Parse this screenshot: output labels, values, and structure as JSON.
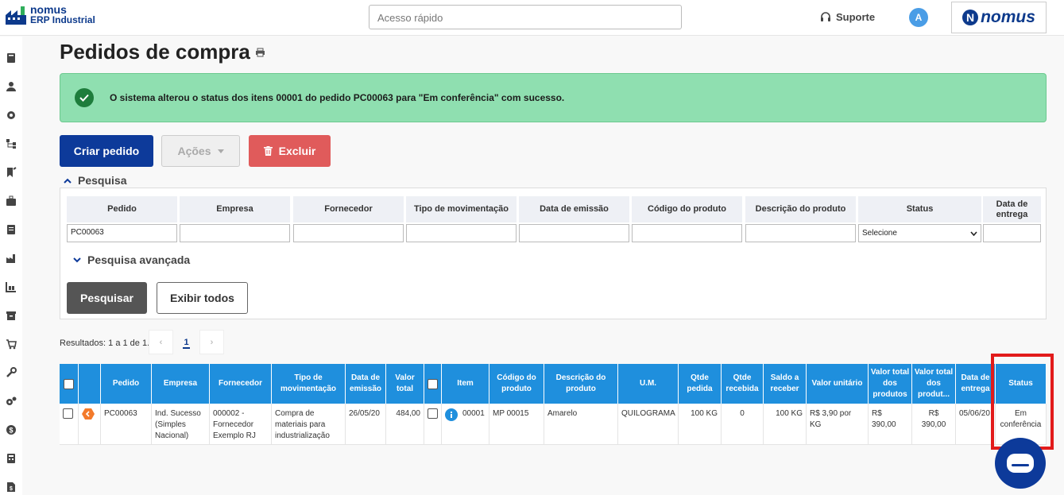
{
  "header": {
    "logo_line1": "nomus",
    "logo_line2": "ERP Industrial",
    "quick_access_placeholder": "Acesso rápido",
    "support_label": "Suporte",
    "avatar_letter": "A",
    "brand_letter": "N",
    "brand_word": "nomus"
  },
  "page": {
    "title": "Pedidos de compra",
    "alert_message": "O sistema alterou o status dos itens 00001 do pedido PC00063 para \"Em conferência\" com sucesso."
  },
  "toolbar": {
    "create_label": "Criar pedido",
    "actions_label": "Ações",
    "delete_label": "Excluir"
  },
  "search": {
    "section_label": "Pesquisa",
    "columns": [
      "Pedido",
      "Empresa",
      "Fornecedor",
      "Tipo de movimentação",
      "Data de emissão",
      "Código do produto",
      "Descrição do produto",
      "Status",
      "Data de entrega"
    ],
    "pedido_value": "PC00063",
    "status_selected": "Selecione",
    "advanced_label": "Pesquisa avançada",
    "search_button": "Pesquisar",
    "show_all_button": "Exibir todos"
  },
  "pagination": {
    "results_text": "Resultados: 1 a 1 de 1.",
    "prev": "‹",
    "current": "1",
    "next": "›"
  },
  "table": {
    "headers": [
      "Pedido",
      "Empresa",
      "Fornecedor",
      "Tipo de movimentação",
      "Data de emissão",
      "Valor total",
      "Item",
      "Código do produto",
      "Descrição do produto",
      "U.M.",
      "Qtde pedida",
      "Qtde recebida",
      "Saldo a receber",
      "Valor unitário",
      "Valor total dos produtos",
      "Valor total dos produt...",
      "Data de entrega",
      "Status"
    ],
    "row": {
      "pedido": "PC00063",
      "empresa": "Ind. Sucesso (Simples Nacional)",
      "fornecedor": "000002 - Fornecedor Exemplo RJ",
      "tipo": "Compra de materiais para industrialização",
      "data_emissao": "26/05/20",
      "valor_total": "484,00",
      "item": "00001",
      "codigo": "MP 00015",
      "descricao": "Amarelo",
      "um": "QUILOGRAMA",
      "qtde_pedida": "100 KG",
      "qtde_recebida": "0",
      "saldo": "100 KG",
      "valor_unitario": "R$ 3,90 por KG",
      "valor_total_produtos": "R$ 390,00",
      "valor_total_produt2": "R$ 390,00",
      "data_entrega": "05/06/20",
      "status": "Em conferência"
    }
  },
  "colors": {
    "primary": "#0d3a9a",
    "header_blue": "#1f8fdd",
    "success_bg": "#8fdfb0",
    "danger": "#e05b5b",
    "highlight": "#e21b1b"
  }
}
